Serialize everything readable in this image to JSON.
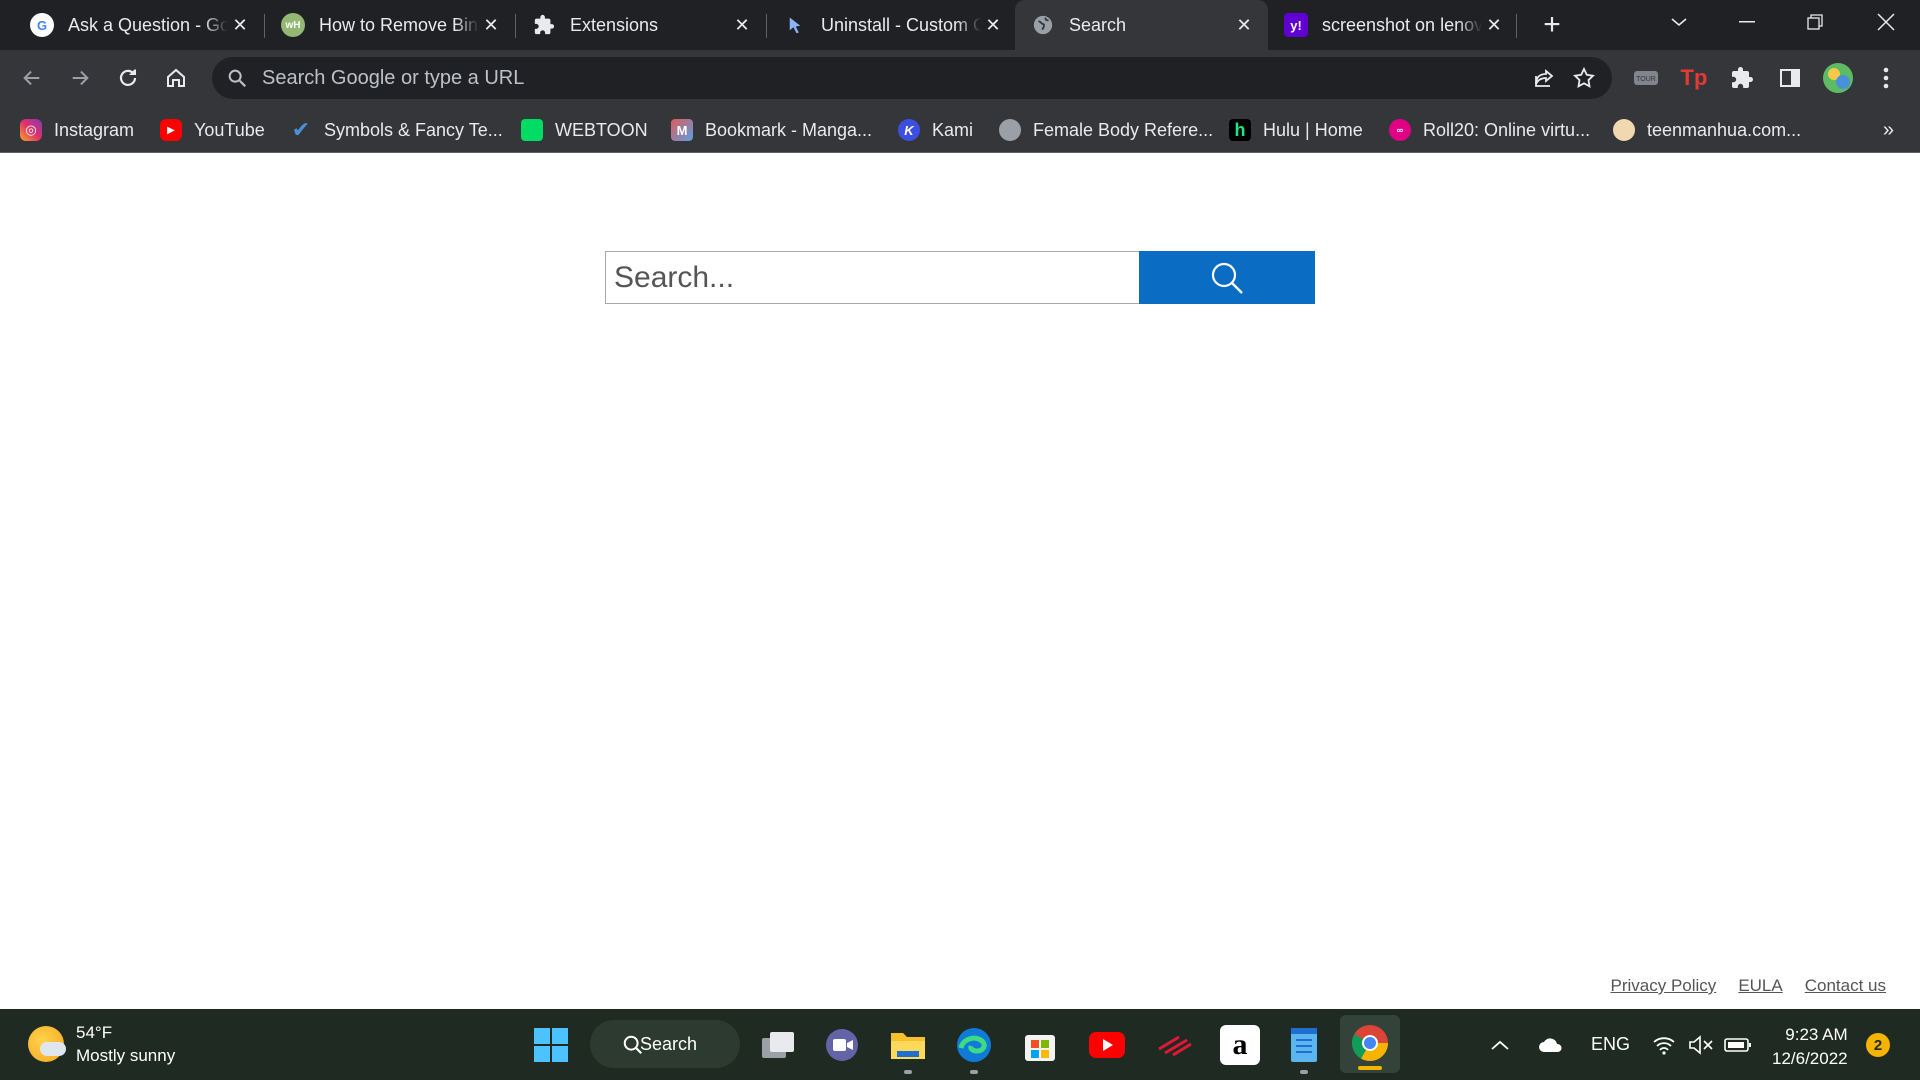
{
  "browser": {
    "tabs": [
      {
        "title": "Ask a Question - Go",
        "favicon": "google-icon",
        "active": false
      },
      {
        "title": "How to Remove Bing",
        "favicon": "wikihow-icon",
        "active": false
      },
      {
        "title": "Extensions",
        "favicon": "puzzle-icon",
        "active": false
      },
      {
        "title": "Uninstall - Custom Cursor",
        "favicon": "cursor-icon",
        "active": false
      },
      {
        "title": "Search",
        "favicon": "globe-icon",
        "active": true
      },
      {
        "title": "screenshot on lenovo",
        "favicon": "yahoo-icon",
        "active": false
      }
    ],
    "omnibox_placeholder": "Search Google or type a URL",
    "bookmarks": [
      {
        "label": "Instagram",
        "icon": "instagram-icon",
        "color": "#e1306c"
      },
      {
        "label": "YouTube",
        "icon": "youtube-icon",
        "color": "#ff0000"
      },
      {
        "label": "Symbols & Fancy Te...",
        "icon": "checkmark-icon",
        "color": "#4a90d9"
      },
      {
        "label": "WEBTOON",
        "icon": "webtoon-icon",
        "color": "#00dc64"
      },
      {
        "label": "Bookmark - Manga...",
        "icon": "manga-icon",
        "color": "#e05a5a"
      },
      {
        "label": "Kami",
        "icon": "kami-icon",
        "color": "#3c4fe0"
      },
      {
        "label": "Female Body Refere...",
        "icon": "globe-icon",
        "color": "#9aa0a6"
      },
      {
        "label": "Hulu | Home",
        "icon": "hulu-icon",
        "color": "#1ce783"
      },
      {
        "label": "Roll20: Online virtu...",
        "icon": "roll20-icon",
        "color": "#e10085"
      },
      {
        "label": "teenmanhua.com...",
        "icon": "teenmanhua-icon",
        "color": "#f1d8b0"
      }
    ]
  },
  "page": {
    "search_placeholder": "Search...",
    "footer_links": [
      "Privacy Policy",
      "EULA",
      "Contact us"
    ],
    "accent_color": "#0a6cc2"
  },
  "taskbar": {
    "weather_temp": "54°F",
    "weather_desc": "Mostly sunny",
    "search_label": "Search",
    "language": "ENG",
    "time": "9:23 AM",
    "date": "12/6/2022",
    "notification_count": "2"
  }
}
